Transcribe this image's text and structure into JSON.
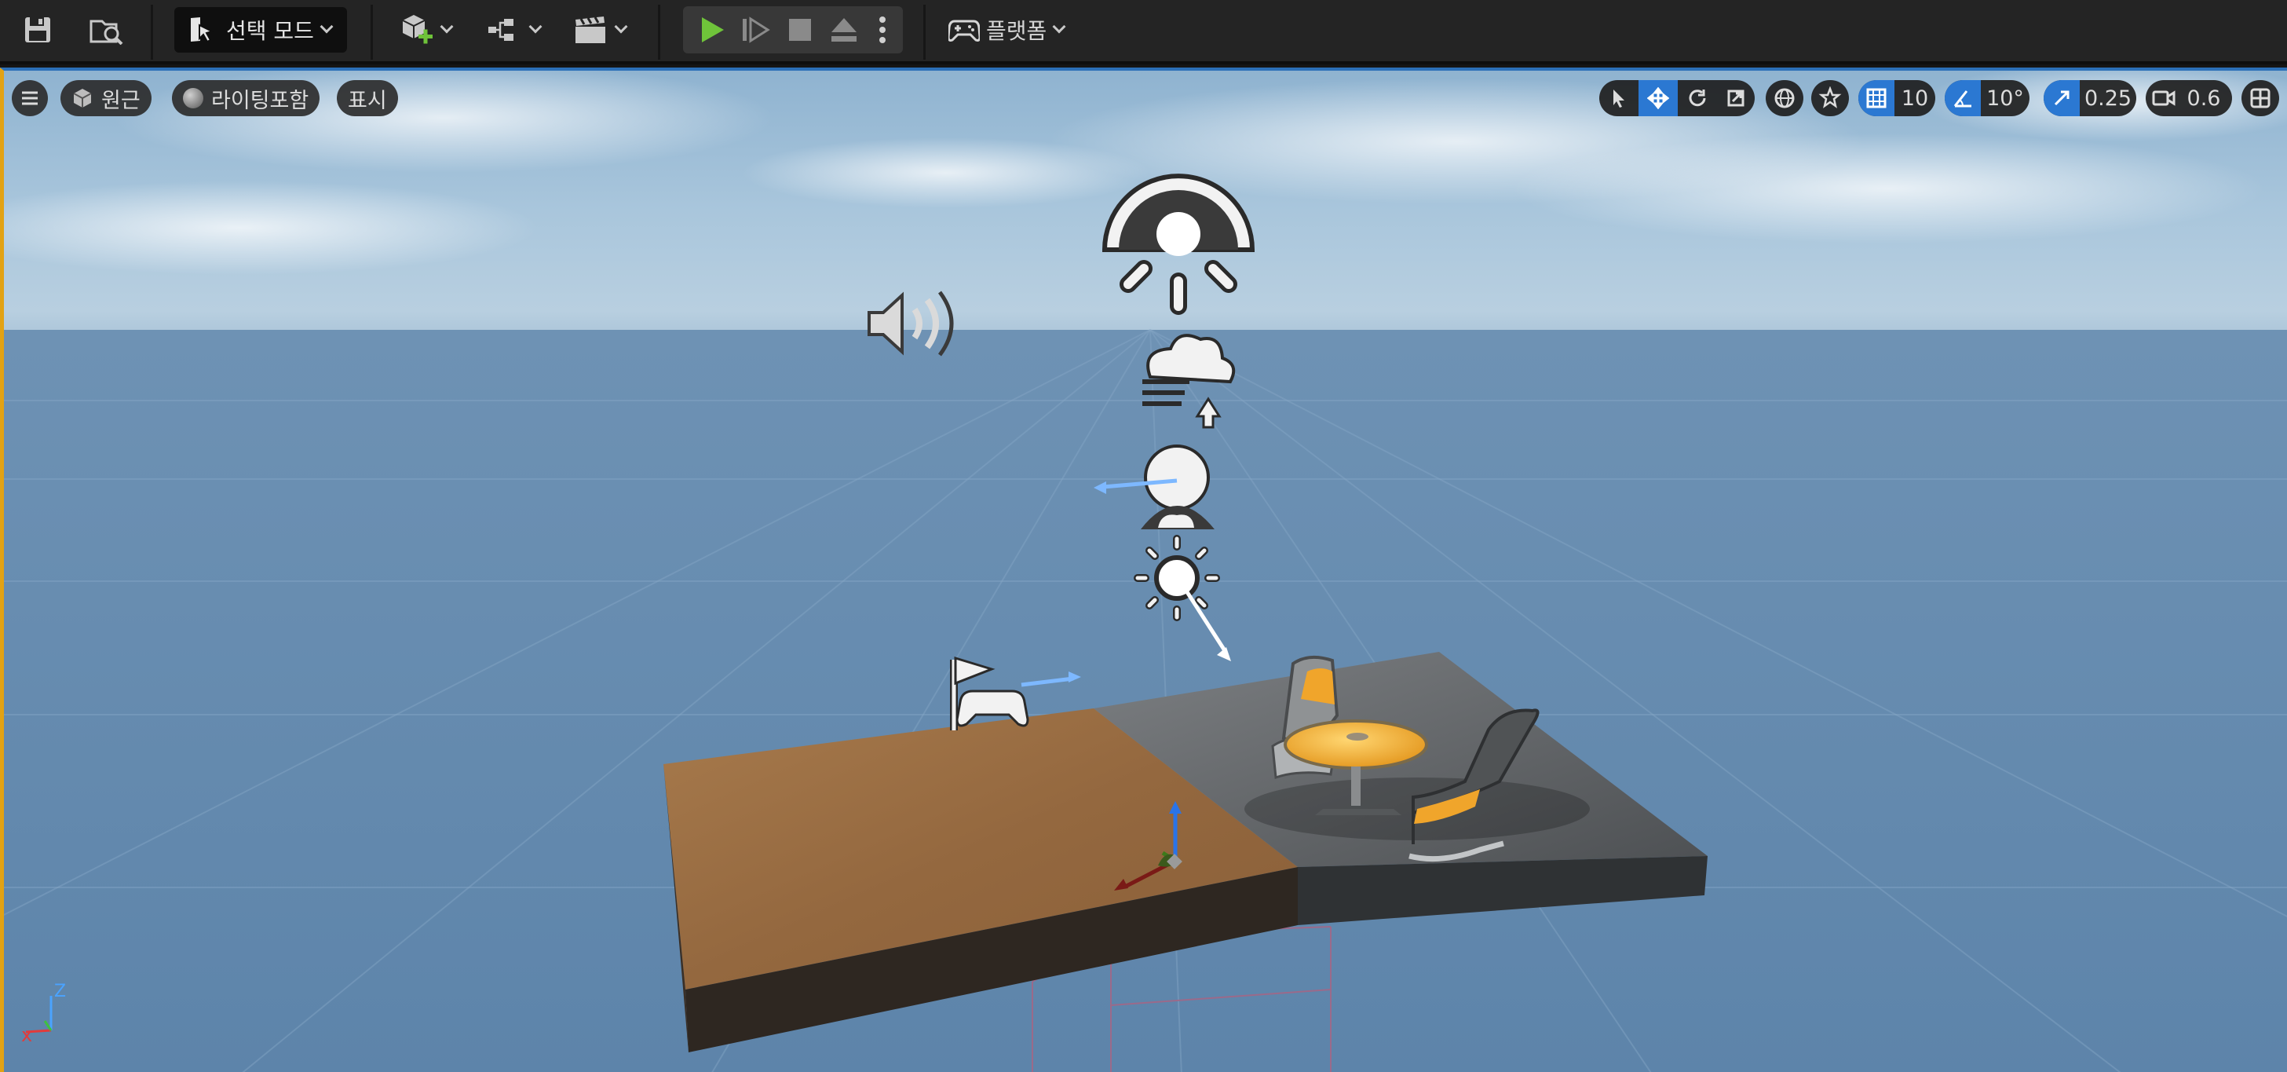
{
  "toolbar": {
    "save_icon": "save-icon",
    "browse_icon": "content-browser-icon",
    "mode_label": "선택 모드",
    "add_actor_icon": "add-actor-icon",
    "blueprint_icon": "blueprint-icon",
    "cinematics_icon": "clapperboard-icon",
    "play_icon": "play-icon",
    "step_icon": "frame-step-icon",
    "stop_icon": "stop-icon",
    "eject_icon": "eject-icon",
    "more_icon": "vertical-dots-icon",
    "platform_label": "플랫폼"
  },
  "viewport": {
    "menu_icon": "hamburger-icon",
    "perspective_label": "원근",
    "lighting_label": "라이팅포함",
    "show_label": "표시",
    "grid_snap_value": "10",
    "rotation_snap_value": "10°",
    "scale_snap_value": "0.25",
    "camera_speed_value": "0.6",
    "axis": {
      "z": "Z"
    }
  },
  "colors": {
    "toolbar_bg": "#242424",
    "accent_blue": "#2b78d2",
    "play_green": "#6fc33a",
    "viewport_border": "#e2a214",
    "dirt": "#9a6d44",
    "concrete": "#5f6264",
    "chair_yellow": "#f0a52b"
  }
}
